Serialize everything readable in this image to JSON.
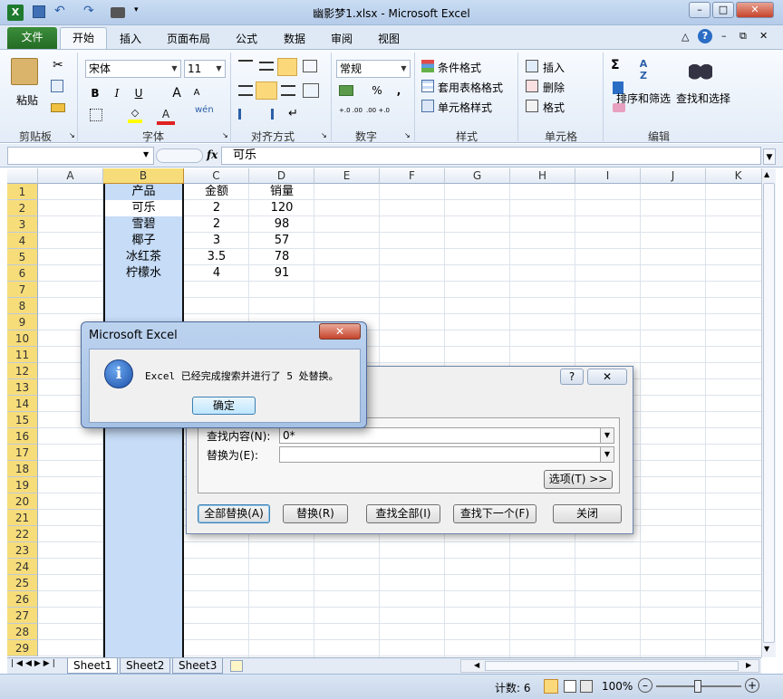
{
  "app": {
    "title": "幽影梦1.xlsx - Microsoft Excel",
    "quick_access": [
      "save-icon",
      "undo-icon",
      "redo-icon",
      "camera-icon"
    ]
  },
  "ribbon": {
    "tabs": [
      "文件",
      "开始",
      "插入",
      "页面布局",
      "公式",
      "数据",
      "审阅",
      "视图"
    ],
    "active_tab": "开始",
    "clipboard": {
      "paste": "粘贴",
      "label": "剪贴板"
    },
    "font": {
      "name": "宋体",
      "size": "11",
      "bold": "B",
      "italic": "I",
      "underline": "U",
      "grow": "A",
      "shrink": "A",
      "color_a": "A",
      "phonetic": "wén",
      "label": "字体"
    },
    "alignment": {
      "label": "对齐方式"
    },
    "number": {
      "format": "常规",
      "percent": "%",
      "comma": ",",
      "inc": "+.0 .00",
      "dec": ".00 +.0",
      "label": "数字"
    },
    "styles": {
      "conditional": "条件格式",
      "table": "套用表格格式",
      "cell": "单元格样式",
      "label": "样式"
    },
    "cells": {
      "insert": "插入",
      "delete": "删除",
      "format": "格式",
      "label": "单元格"
    },
    "editing": {
      "sigma": "Σ",
      "sort": "排序和筛选",
      "find": "查找和选择",
      "label": "编辑"
    }
  },
  "formula_bar": {
    "name_box": "",
    "fx": "fx",
    "value": "可乐"
  },
  "grid": {
    "columns": [
      "A",
      "B",
      "C",
      "D",
      "E",
      "F",
      "G",
      "H",
      "I",
      "J",
      "K"
    ],
    "rows": [
      "1",
      "2",
      "3",
      "4",
      "5",
      "6",
      "7",
      "8",
      "9",
      "10",
      "11",
      "12",
      "13",
      "14",
      "15",
      "16",
      "17",
      "18",
      "19",
      "20",
      "21",
      "22",
      "23",
      "24",
      "25",
      "26",
      "27",
      "28",
      "29"
    ],
    "headers": [
      "产品",
      "金额",
      "销量"
    ],
    "data": [
      [
        "可乐",
        "2",
        "120"
      ],
      [
        "雪碧",
        "2",
        "98"
      ],
      [
        "椰子",
        "3",
        "57"
      ],
      [
        "冰红茶",
        "3.5",
        "78"
      ],
      [
        "柠檬水",
        "4",
        "91"
      ]
    ]
  },
  "sheets": [
    "Sheet1",
    "Sheet2",
    "Sheet3"
  ],
  "status": {
    "count": "计数: 6",
    "zoom": "100%"
  },
  "replace_dialog": {
    "find_label": "查找内容(N):",
    "find_value": "0*",
    "replace_label": "替换为(E):",
    "replace_value": "",
    "options": "选项(T) >>",
    "replace_all": "全部替换(A)",
    "replace": "替换(R)",
    "find_all": "查找全部(I)",
    "find_next": "查找下一个(F)",
    "close": "关闭",
    "help": "?"
  },
  "message_box": {
    "title": "Microsoft Excel",
    "text": "Excel 已经完成搜索并进行了 5 处替换。",
    "ok": "确定"
  }
}
